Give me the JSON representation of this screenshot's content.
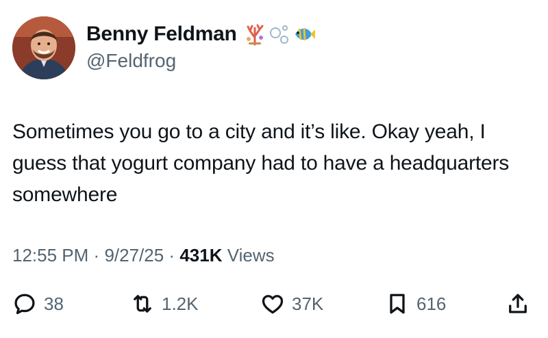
{
  "author": {
    "display_name": "Benny Feldman",
    "handle": "@Feldfrog",
    "avatar_icon": "avatar-photo",
    "name_emojis": [
      "coral-icon",
      "bubbles-icon",
      "tropical-fish-icon"
    ]
  },
  "tweet": {
    "text": "Sometimes you go to a city and it’s like. Okay yeah, I guess that yogurt company had to have a headquarters somewhere"
  },
  "meta": {
    "time": "12:55 PM",
    "separator": "·",
    "date": "9/27/25",
    "views_count": "431K",
    "views_label": "Views"
  },
  "actions": {
    "replies": "38",
    "reposts": "1.2K",
    "likes": "37K",
    "bookmarks": "616"
  },
  "colors": {
    "text": "#0f1419",
    "secondary": "#536471"
  }
}
